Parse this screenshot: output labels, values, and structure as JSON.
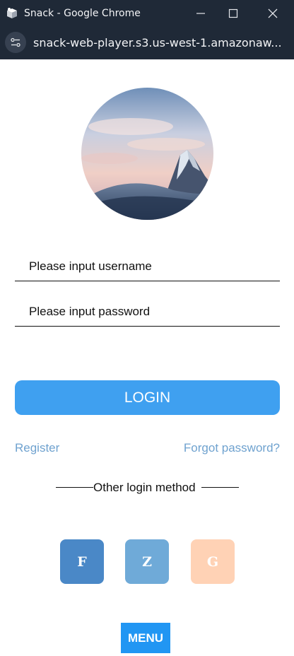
{
  "window": {
    "title": "Snack - Google Chrome",
    "url": "snack-web-player.s3.us-west-1.amazonaw..."
  },
  "avatar": {
    "icon": "mountain-photo"
  },
  "form": {
    "username_placeholder": "Please input username",
    "password_placeholder": "Please input password",
    "login_label": "LOGIN"
  },
  "links": {
    "register": "Register",
    "forgot": "Forgot password?"
  },
  "other_login": {
    "label": "Other login method",
    "buttons": [
      {
        "label": "F",
        "color": "#4a88c7"
      },
      {
        "label": "Z",
        "color": "#6faad8"
      },
      {
        "label": "G",
        "color": "#ffd2b5"
      }
    ]
  },
  "menu": {
    "label": "MENU"
  },
  "colors": {
    "primary": "#3fa0f0",
    "link": "#6fa2cf",
    "menu": "#2196f3"
  }
}
